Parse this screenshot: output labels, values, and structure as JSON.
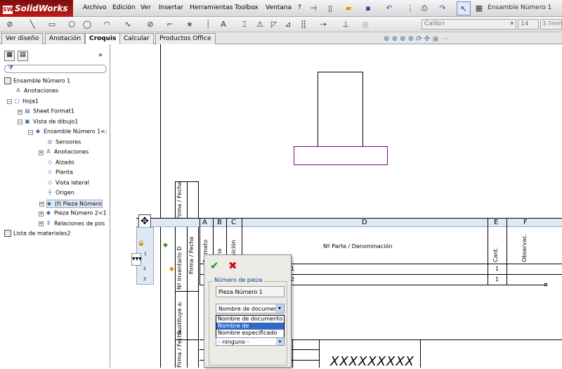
{
  "app": {
    "brand": "SolidWorks",
    "brand_icon": "SW"
  },
  "menu": [
    "Archivo",
    "Edición",
    "Ver",
    "Insertar",
    "Herramientas",
    "Toolbox",
    "Ventana",
    "?"
  ],
  "doc_title": "Ensamble Número 1",
  "font": {
    "family": "Calibri",
    "size": "14",
    "height": "3.7mm"
  },
  "tabs": [
    "Ver diseño",
    "Anotación",
    "Croquis",
    "Calcular",
    "Productos Office"
  ],
  "tree": {
    "root": "Ensamble Número 1",
    "items": [
      {
        "label": "Anotaciones",
        "indent": 1
      },
      {
        "label": "Hoja1",
        "indent": 1
      },
      {
        "label": "Sheet Format1",
        "indent": 2
      },
      {
        "label": "Vista de dibujo1",
        "indent": 2
      },
      {
        "label": "Ensamble Número 1<:",
        "indent": 3
      },
      {
        "label": "Sensores",
        "indent": 4
      },
      {
        "label": "Anotaciones",
        "indent": 4
      },
      {
        "label": "Alzado",
        "indent": 4
      },
      {
        "label": "Planta",
        "indent": 4
      },
      {
        "label": "Vista lateral",
        "indent": 4
      },
      {
        "label": "Origen",
        "indent": 4
      },
      {
        "label": "(f) Pieza Número",
        "indent": 4
      },
      {
        "label": "Pieza Número 2<1",
        "indent": 4
      },
      {
        "label": "Relaciones de pos",
        "indent": 4
      }
    ],
    "footer": "Lista de materiales2"
  },
  "bom": {
    "col_letters": [
      "A",
      "B",
      "C",
      "D",
      "E",
      "F"
    ],
    "headers": [
      "Formato",
      "Zona",
      "Posición",
      "Nº Parte / Denominación",
      "Cant.",
      "Observac."
    ],
    "row_numbers": [
      "1",
      "2",
      "3"
    ],
    "rows": [
      {
        "pos": "1",
        "qty": "1"
      },
      {
        "pos": "2",
        "qty": "1"
      }
    ]
  },
  "side_labels": [
    "Firma / Fecha",
    "Nº Inventario D",
    "Sustituye a:",
    "Firma / Fecha"
  ],
  "dialog": {
    "group": "Número de pieza",
    "value": "Pieza Número 1",
    "select": "Nombre de document",
    "options": [
      "Nombre de documento",
      "Nombre de configuración",
      "Nombre especificado por"
    ],
    "second_select": "- ninguno -"
  },
  "title_block": "XXXXXXXXX",
  "colors": {
    "accent": "#316ac5",
    "profile": "#800080"
  }
}
